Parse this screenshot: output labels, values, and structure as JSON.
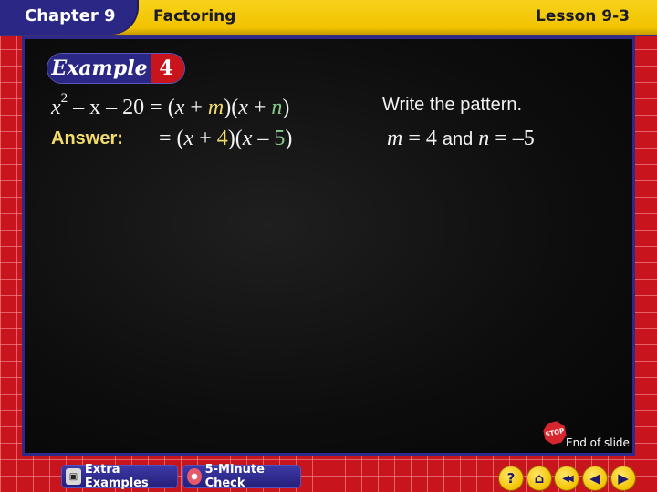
{
  "header": {
    "chapter": "Chapter 9",
    "topic": "Factoring",
    "lesson": "Lesson 9-3"
  },
  "example": {
    "label": "Example",
    "number": "4"
  },
  "content": {
    "equation1": {
      "x": "x",
      "exp": "2",
      "rest": " – x – 20 = (",
      "x2": "x",
      "plus1": " + ",
      "m": "m",
      "mid": ")(",
      "x3": "x",
      "plus2": " + ",
      "n": "n",
      "close": ")"
    },
    "answer_label": "Answer:",
    "equation2": {
      "open": "= (",
      "x": "x",
      "plus": " + ",
      "four": "4",
      "mid": ")(",
      "x2": "x",
      "minus": " – ",
      "five": "5",
      "close": ")"
    },
    "note": "Write the pattern.",
    "equation3": {
      "m": "m",
      "m_eq": " = 4 ",
      "and": "and",
      "n": " n",
      "n_eq": " = –5"
    },
    "colors": {
      "highlight_yellow": "#f3dc6a",
      "highlight_green": "#86c98a"
    }
  },
  "end_of_slide": {
    "stop_icon_text": "STOP",
    "label": "End of slide"
  },
  "footer": {
    "extra_examples": "Extra Examples",
    "five_minute_check": "5-Minute Check",
    "nav": {
      "help": "?",
      "home": "⌂",
      "first": "◀◀",
      "prev": "◀",
      "next": "▶"
    }
  }
}
